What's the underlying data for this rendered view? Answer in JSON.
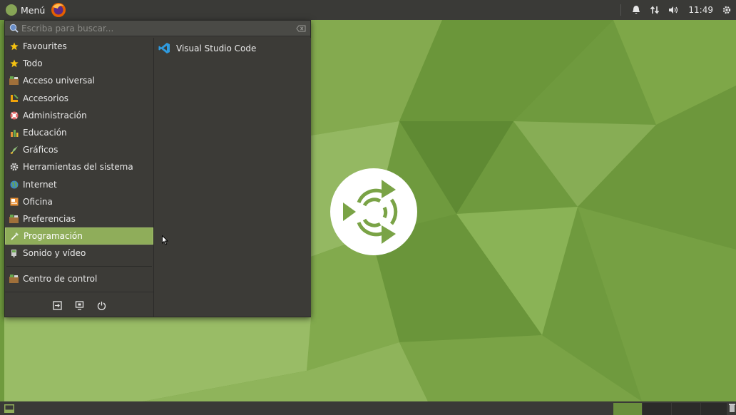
{
  "top_panel": {
    "menu_label": "Menú",
    "clock": "11:49"
  },
  "search": {
    "placeholder": "Escriba para buscar..."
  },
  "categories": [
    {
      "label": "Favourites",
      "icon": "star-icon"
    },
    {
      "label": "Todo",
      "icon": "star-icon"
    },
    {
      "label": "Acceso universal",
      "icon": "accessibility-icon"
    },
    {
      "label": "Accesorios",
      "icon": "accessories-icon"
    },
    {
      "label": "Administración",
      "icon": "administration-icon"
    },
    {
      "label": "Educación",
      "icon": "education-icon"
    },
    {
      "label": "Gráficos",
      "icon": "graphics-icon"
    },
    {
      "label": "Herramientas del sistema",
      "icon": "gear-icon"
    },
    {
      "label": "Internet",
      "icon": "globe-icon"
    },
    {
      "label": "Oficina",
      "icon": "office-icon"
    },
    {
      "label": "Preferencias",
      "icon": "preferences-icon"
    },
    {
      "label": "Programación",
      "icon": "programming-icon",
      "selected": true
    },
    {
      "label": "Sonido y vídeo",
      "icon": "multimedia-icon"
    },
    {
      "label": "Centro de control",
      "icon": "control-center-icon"
    }
  ],
  "apps": [
    {
      "label": "Visual Studio Code",
      "icon": "vscode-icon"
    }
  ],
  "session_buttons": [
    "logout-icon",
    "lock-screen-icon",
    "power-icon"
  ],
  "colors": {
    "panel": "#3a3a37",
    "menu_bg": "#3c3b37",
    "accent": "#8fad5a",
    "wallpaper": "#6f9a3e"
  }
}
